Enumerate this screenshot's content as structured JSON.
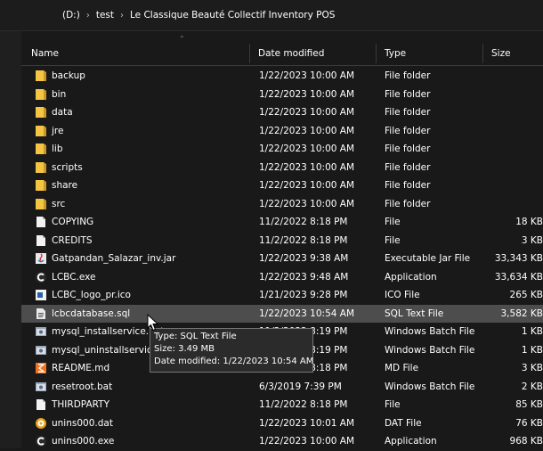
{
  "breadcrumb": [
    "(D:)",
    "test",
    "Le Classique Beauté Collectif Inventory POS"
  ],
  "columns": {
    "name": "Name",
    "date": "Date modified",
    "type": "Type",
    "size": "Size"
  },
  "files": [
    {
      "name": "backup",
      "date": "1/22/2023 10:00 AM",
      "type": "File folder",
      "size": "",
      "icon": "folder-icon"
    },
    {
      "name": "bin",
      "date": "1/22/2023 10:00 AM",
      "type": "File folder",
      "size": "",
      "icon": "folder-icon"
    },
    {
      "name": "data",
      "date": "1/22/2023 10:00 AM",
      "type": "File folder",
      "size": "",
      "icon": "folder-icon"
    },
    {
      "name": "jre",
      "date": "1/22/2023 10:00 AM",
      "type": "File folder",
      "size": "",
      "icon": "folder-icon"
    },
    {
      "name": "lib",
      "date": "1/22/2023 10:00 AM",
      "type": "File folder",
      "size": "",
      "icon": "folder-icon"
    },
    {
      "name": "scripts",
      "date": "1/22/2023 10:00 AM",
      "type": "File folder",
      "size": "",
      "icon": "folder-icon"
    },
    {
      "name": "share",
      "date": "1/22/2023 10:00 AM",
      "type": "File folder",
      "size": "",
      "icon": "folder-icon"
    },
    {
      "name": "src",
      "date": "1/22/2023 10:00 AM",
      "type": "File folder",
      "size": "",
      "icon": "folder-icon"
    },
    {
      "name": "COPYING",
      "date": "11/2/2022 8:18 PM",
      "type": "File",
      "size": "18 KB",
      "icon": "file-icon"
    },
    {
      "name": "CREDITS",
      "date": "11/2/2022 8:18 PM",
      "type": "File",
      "size": "3 KB",
      "icon": "file-icon"
    },
    {
      "name": "Gatpandan_Salazar_inv.jar",
      "date": "1/22/2023 9:38 AM",
      "type": "Executable Jar File",
      "size": "33,343 KB",
      "icon": "java-icon"
    },
    {
      "name": "LCBC.exe",
      "date": "1/22/2023 9:48 AM",
      "type": "Application",
      "size": "33,634 KB",
      "icon": "app-c-icon"
    },
    {
      "name": "LCBC_logo_pr.ico",
      "date": "1/21/2023 9:28 PM",
      "type": "ICO File",
      "size": "265 KB",
      "icon": "ico-icon"
    },
    {
      "name": "lcbcdatabase.sql",
      "date": "1/22/2023 10:54 AM",
      "type": "SQL Text File",
      "size": "3,582 KB",
      "icon": "sql-icon",
      "selected": true
    },
    {
      "name": "mysql_installservice.bat",
      "date": "11/2/2022 8:19 PM",
      "type": "Windows Batch File",
      "size": "1 KB",
      "icon": "batch-icon"
    },
    {
      "name": "mysql_uninstallservice.bat",
      "date": "11/2/2022 8:19 PM",
      "type": "Windows Batch File",
      "size": "1 KB",
      "icon": "batch-icon"
    },
    {
      "name": "README.md",
      "date": "11/2/2022 8:18 PM",
      "type": "MD File",
      "size": "3 KB",
      "icon": "md-icon"
    },
    {
      "name": "resetroot.bat",
      "date": "6/3/2019 7:39 PM",
      "type": "Windows Batch File",
      "size": "2 KB",
      "icon": "batch-icon"
    },
    {
      "name": "THIRDPARTY",
      "date": "11/2/2022 8:18 PM",
      "type": "File",
      "size": "85 KB",
      "icon": "file-icon"
    },
    {
      "name": "unins000.dat",
      "date": "1/22/2023 10:01 AM",
      "type": "DAT File",
      "size": "76 KB",
      "icon": "dat-icon"
    },
    {
      "name": "unins000.exe",
      "date": "1/22/2023 10:00 AM",
      "type": "Application",
      "size": "968 KB",
      "icon": "app-c-icon"
    }
  ],
  "tooltip": {
    "type_line": "Type: SQL Text File",
    "size_line": "Size: 3.49 MB",
    "date_line": "Date modified: 1/22/2023 10:54 AM"
  },
  "colors": {
    "folder": "#f4c542",
    "background": "#191919",
    "selected": "#4d4d4d"
  }
}
